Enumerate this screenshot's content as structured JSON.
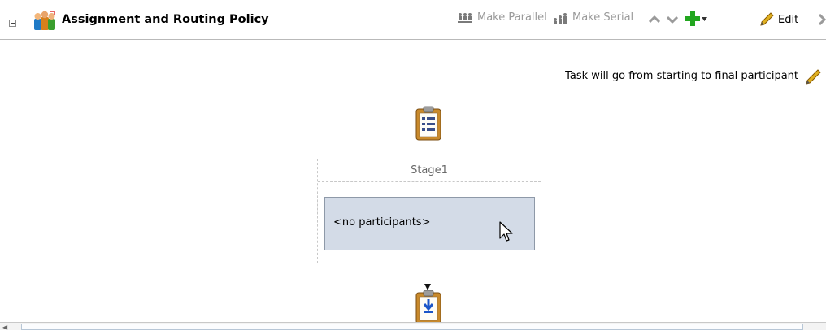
{
  "header": {
    "title": "Assignment and Routing Policy",
    "toolbar": {
      "make_parallel": "Make Parallel",
      "make_serial": "Make Serial",
      "edit": "Edit"
    },
    "icons": {
      "collapse": "collapse-icon",
      "title": "routing-policy-icon",
      "make_parallel": "parallel-icon",
      "make_serial": "serial-icon",
      "move_up": "chevron-up-icon",
      "move_down": "chevron-down-icon",
      "add": "add-icon",
      "edit": "pencil-icon",
      "more": "chevron-right-icon"
    }
  },
  "diagram": {
    "hint": "Task will go from starting to final participant",
    "stage_label": "Stage1",
    "participant_placeholder": "<no participants>",
    "start_icon": "task-start-icon",
    "end_icon": "task-end-icon"
  },
  "colors": {
    "participant_fill": "#d3dbe7",
    "participant_border": "#8e99a8",
    "accent_green": "#22a61f",
    "pencil": "#d4a21a",
    "disabled_text": "#9a9a9a"
  }
}
